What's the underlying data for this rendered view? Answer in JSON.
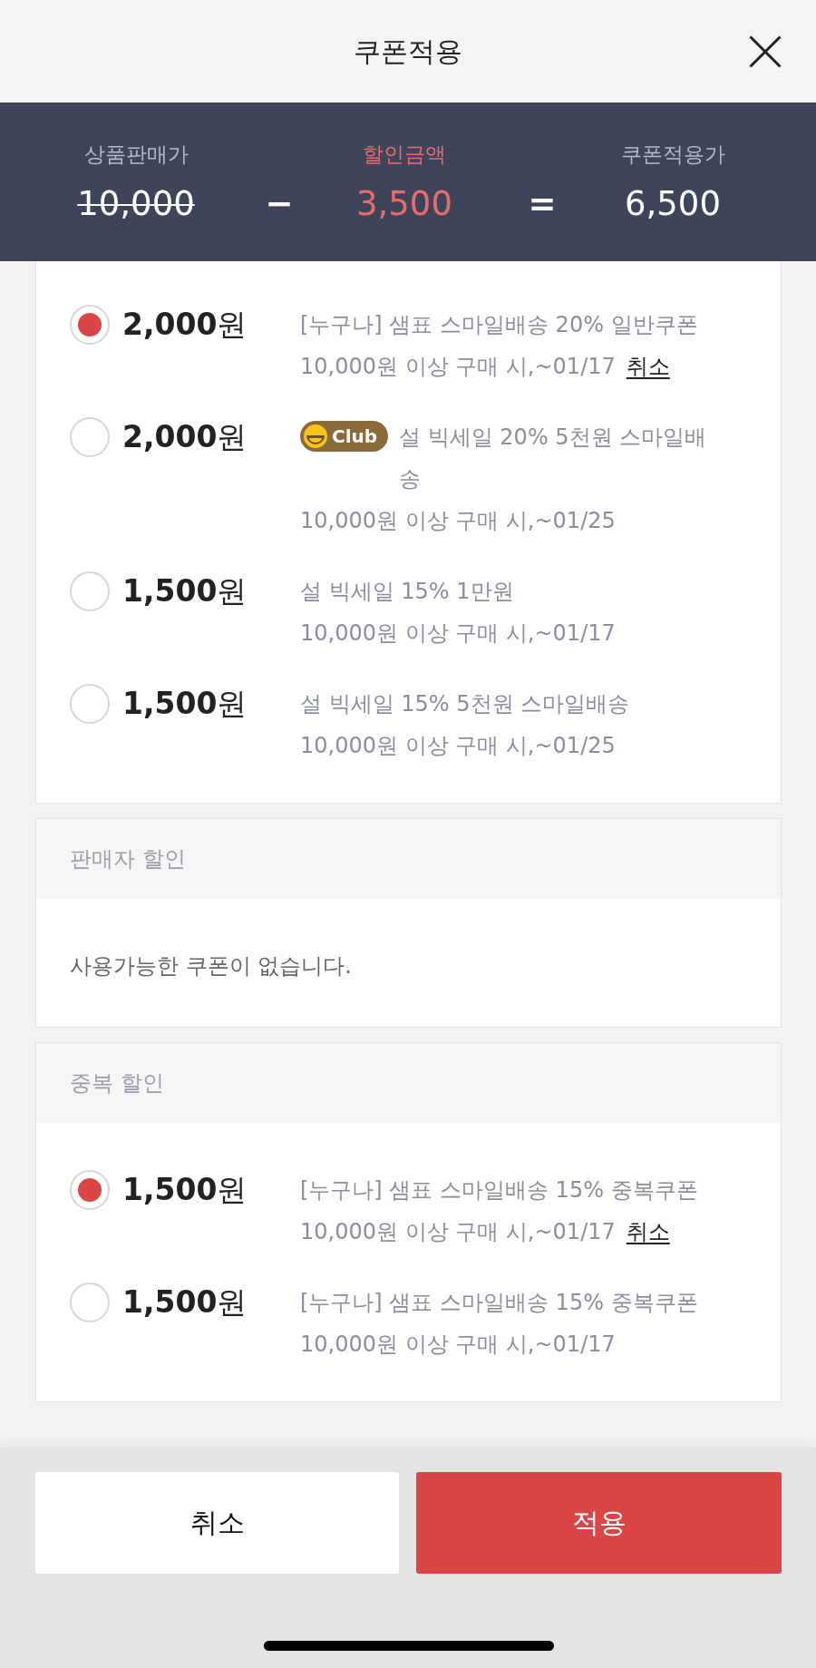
{
  "header": {
    "title": "쿠폰적용"
  },
  "summary": [
    {
      "kind": "price",
      "label": "상품판매가",
      "value": "10,000"
    },
    {
      "kind": "operator",
      "value": "−"
    },
    {
      "kind": "discount",
      "label": "할인금액",
      "value": "3,500"
    },
    {
      "kind": "operator",
      "value": "="
    },
    {
      "kind": "result",
      "label": "쿠폰적용가",
      "value": "6,500"
    }
  ],
  "sections": [
    {
      "coupons": [
        {
          "amount": "**2,000**원",
          "selected": true,
          "name": "[누구나] 샘표 스마일배송 20% 일반쿠폰",
          "condition": "10,000원 이상 구매 시,~01/17",
          "cancel_link": "취소"
        },
        {
          "amount": "**2,000**원",
          "selected": false,
          "badge": "Club",
          "name": "설 빅세일 20% 5천원 스마일배송",
          "condition": "10,000원 이상 구매 시,~01/25"
        },
        {
          "amount": "**1,500**원",
          "selected": false,
          "name": "설 빅세일 15% 1만원",
          "condition": "10,000원 이상 구매 시,~01/17"
        },
        {
          "amount": "**1,500**원",
          "selected": false,
          "name": "설 빅세일 15% 5천원 스마일배송",
          "condition": "10,000원 이상 구매 시,~01/25"
        }
      ]
    },
    {
      "title": "판매자 할인",
      "empty_message": "사용가능한 쿠폰이 없습니다."
    },
    {
      "title": "중복 할인",
      "coupons": [
        {
          "amount": "**1,500**원",
          "selected": true,
          "name": "[누구나] 샘표 스마일배송 15% 중복쿠폰",
          "condition": "10,000원 이상 구매 시,~01/17",
          "cancel_link": "취소"
        },
        {
          "amount": "**1,500**원",
          "selected": false,
          "name": "[누구나] 샘표 스마일배송 15% 중복쿠폰",
          "condition": "10,000원 이상 구매 시,~01/17"
        }
      ]
    }
  ],
  "footer_buttons": [
    {
      "kind": "secondary",
      "label": "취소"
    },
    {
      "kind": "primary",
      "label": "적용"
    }
  ]
}
